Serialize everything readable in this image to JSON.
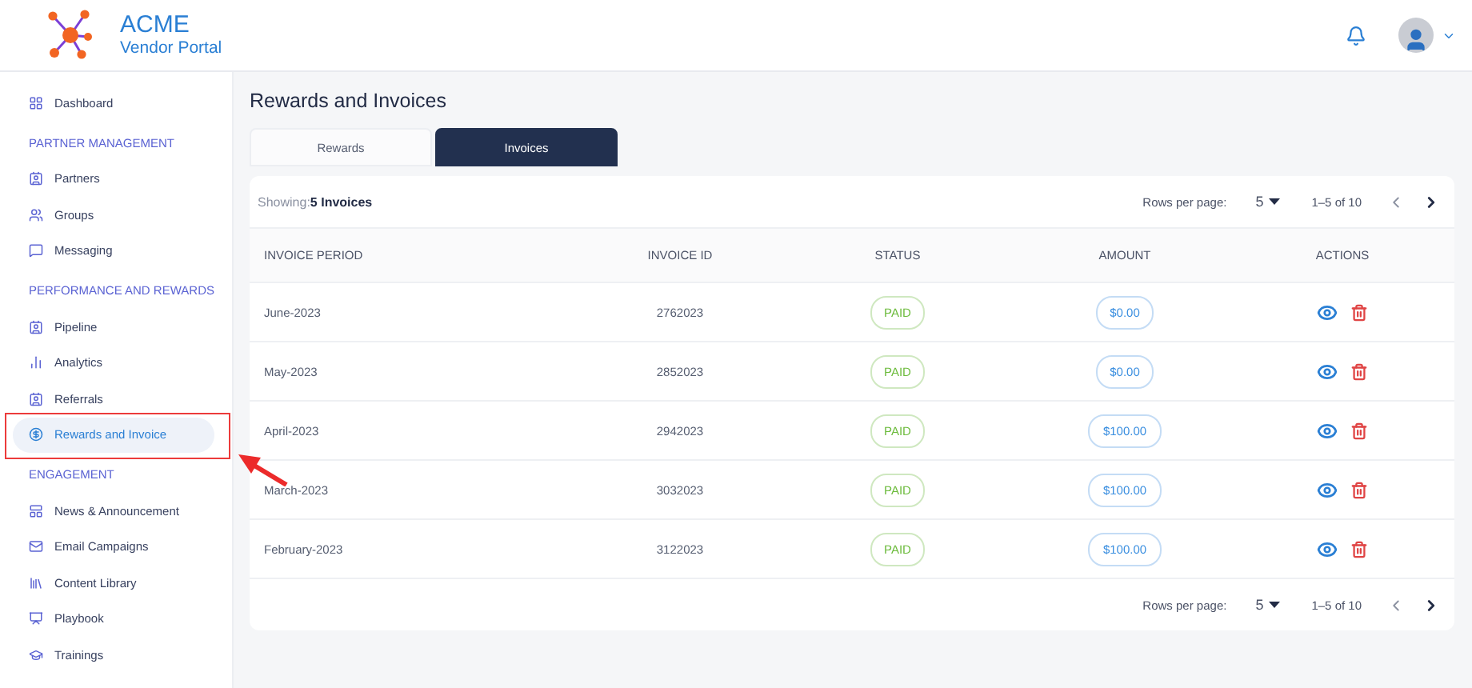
{
  "header": {
    "brand": "ACME",
    "subtitle": "Vendor Portal"
  },
  "sidebar": {
    "sections": [
      {
        "items": [
          {
            "label": "Dashboard",
            "selected": false,
            "callout": false
          }
        ]
      },
      {
        "title": "PARTNER MANAGEMENT",
        "items": [
          {
            "label": "Partners",
            "selected": false,
            "callout": false
          },
          {
            "label": "Groups",
            "selected": false,
            "callout": false
          },
          {
            "label": "Messaging",
            "selected": false,
            "callout": false
          }
        ]
      },
      {
        "title": "PERFORMANCE AND REWARDS",
        "items": [
          {
            "label": "Pipeline",
            "selected": false,
            "callout": false
          },
          {
            "label": "Analytics",
            "selected": false,
            "callout": false
          },
          {
            "label": "Referrals",
            "selected": false,
            "callout": false
          },
          {
            "label": "Rewards and Invoice",
            "selected": true,
            "callout": true
          }
        ]
      },
      {
        "title": "ENGAGEMENT",
        "items": [
          {
            "label": "News & Announcement",
            "selected": false,
            "callout": false
          },
          {
            "label": "Email Campaigns",
            "selected": false,
            "callout": false
          },
          {
            "label": "Content Library",
            "selected": false,
            "callout": false
          },
          {
            "label": "Playbook",
            "selected": false,
            "callout": false
          },
          {
            "label": "Trainings",
            "selected": false,
            "callout": false
          }
        ]
      }
    ]
  },
  "page_title": "Rewards and Invoices",
  "tabs": [
    {
      "label": "Rewards",
      "selected": false
    },
    {
      "label": "Invoices",
      "selected": true
    }
  ],
  "table": {
    "showing_label": "Showing:",
    "showing_count": "5 Invoices",
    "pagination": {
      "rows_label": "Rows per page:",
      "rows_value": "5",
      "range": "1–5 of 10"
    },
    "footer_pagination": {
      "rows_label": "Rows per page:",
      "rows_value": "5",
      "range": "1–5 of 10"
    },
    "columns": [
      "INVOICE PERIOD",
      "INVOICE ID",
      "STATUS",
      "AMOUNT",
      "ACTIONS"
    ],
    "rows": [
      {
        "period": "June-2023",
        "id": "2762023",
        "status": "PAID",
        "amount": "$0.00"
      },
      {
        "period": "May-2023",
        "id": "2852023",
        "status": "PAID",
        "amount": "$0.00"
      },
      {
        "period": "April-2023",
        "id": "2942023",
        "status": "PAID",
        "amount": "$100.00"
      },
      {
        "period": "March-2023",
        "id": "3032023",
        "status": "PAID",
        "amount": "$100.00"
      },
      {
        "period": "February-2023",
        "id": "3122023",
        "status": "PAID",
        "amount": "$100.00"
      }
    ]
  }
}
